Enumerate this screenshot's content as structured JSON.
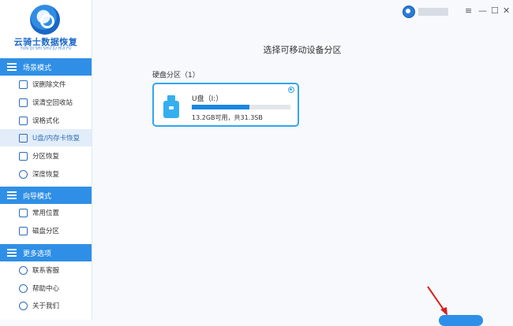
{
  "app": {
    "name": "云骑士数据恢复",
    "subtitle": "YUN QI SHI SHU JU HUI FU"
  },
  "sidebar": {
    "sections": [
      {
        "title": "场景模式",
        "items": [
          {
            "label": "误删除文件",
            "icon": "trash-icon"
          },
          {
            "label": "误清空回收站",
            "icon": "recycle-bin-icon"
          },
          {
            "label": "误格式化",
            "icon": "format-icon"
          },
          {
            "label": "U盘/内存卡恢复",
            "icon": "usb-icon",
            "active": true
          },
          {
            "label": "分区恢复",
            "icon": "partition-icon"
          },
          {
            "label": "深度恢复",
            "icon": "deep-scan-icon"
          }
        ]
      },
      {
        "title": "向导模式",
        "items": [
          {
            "label": "常用位置",
            "icon": "location-icon"
          },
          {
            "label": "磁盘分区",
            "icon": "disk-icon"
          }
        ]
      },
      {
        "title": "更多选项",
        "items": [
          {
            "label": "联系客服",
            "icon": "phone-icon"
          },
          {
            "label": "帮助中心",
            "icon": "help-icon"
          },
          {
            "label": "关于我们",
            "icon": "info-icon"
          }
        ]
      }
    ]
  },
  "window_controls": {
    "menu": "≡",
    "minimize": "—",
    "maximize": "☐",
    "close": "✕"
  },
  "main": {
    "title": "选择可移动设备分区",
    "section_label": "硬盘分区（1）",
    "drives": [
      {
        "name": "U盘（I:）",
        "capacity_text": "13.2GB可用，共31.3SB",
        "used_fraction": 0.58,
        "selected": true
      }
    ]
  },
  "colors": {
    "accent": "#2f8fe6",
    "card_border": "#34a6ef",
    "bar_fill": "#1887e3"
  }
}
